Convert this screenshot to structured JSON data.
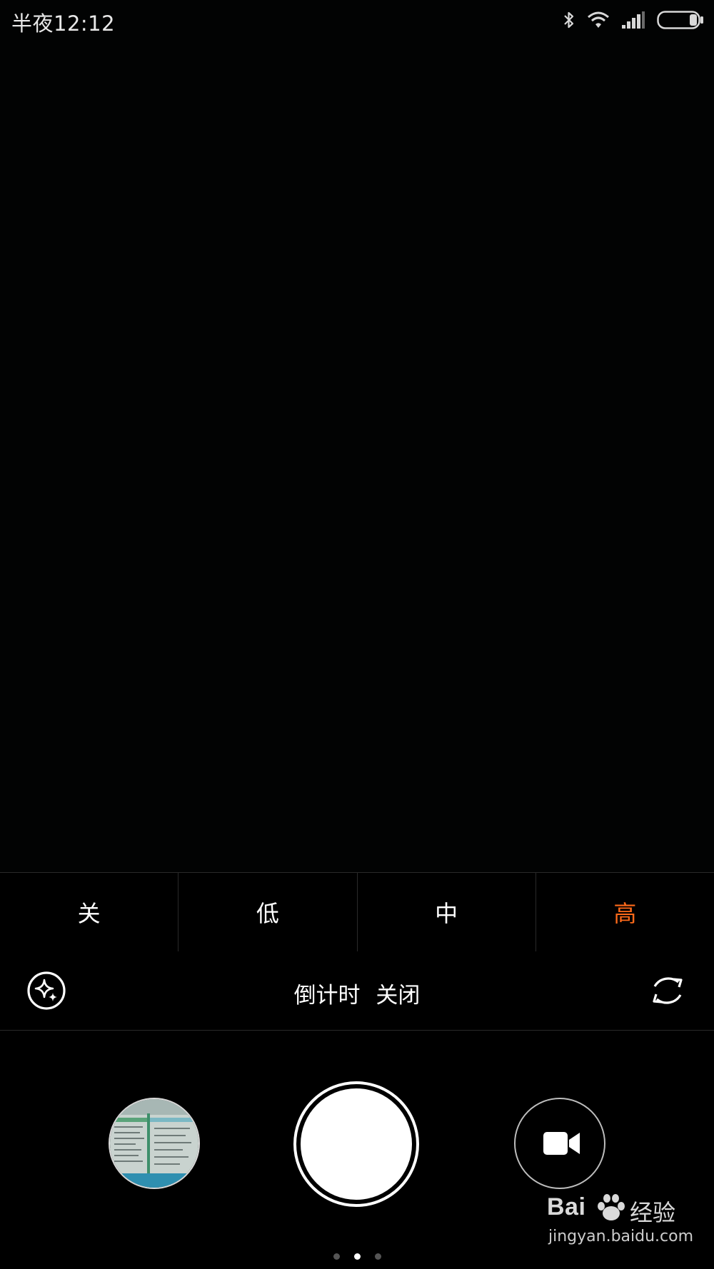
{
  "status_bar": {
    "time": "半夜12:12",
    "icons": [
      "bluetooth-icon",
      "wifi-icon",
      "cell-signal-icon",
      "battery-icon"
    ]
  },
  "beauty_levels": {
    "options": [
      "关",
      "低",
      "中",
      "高"
    ],
    "selected": "高",
    "active_color": "#ff6a1a"
  },
  "settings": {
    "timer_label": "倒计时",
    "timer_value": "关闭",
    "left_icon": "beauty-sparkle-icon",
    "right_icon": "switch-camera-icon"
  },
  "controls": {
    "gallery": "gallery-thumbnail",
    "shutter": "shutter-button",
    "video": "video-camera-icon"
  },
  "pager": {
    "count": 3,
    "active_index": 1
  },
  "watermark": {
    "logo": "Bai",
    "logo_cn": "经验",
    "url": "jingyan.baidu.com"
  }
}
